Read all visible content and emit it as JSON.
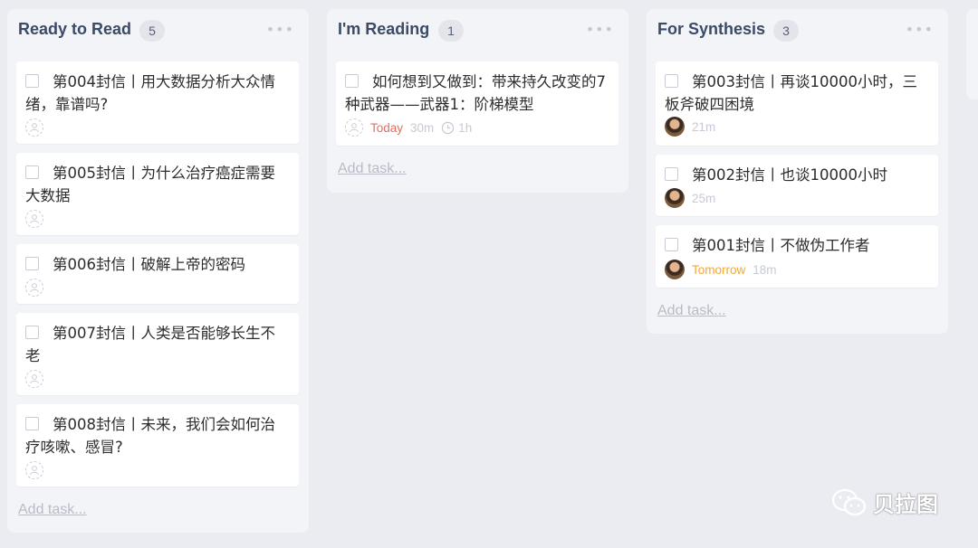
{
  "columns": [
    {
      "title": "Ready to Read",
      "count": "5",
      "menu": "•••",
      "cards": [
        {
          "title": "第004封信丨用大数据分析大众情绪，靠谱吗?"
        },
        {
          "title": "第005封信丨为什么治疗癌症需要大数据"
        },
        {
          "title": "第006封信丨破解上帝的密码"
        },
        {
          "title": "第007封信丨人类是否能够长生不老"
        },
        {
          "title": "第008封信丨未来，我们会如何治疗咳嗽、感冒?"
        }
      ],
      "add_task": "Add task..."
    },
    {
      "title": "I'm Reading",
      "count": "1",
      "menu": "•••",
      "cards": [
        {
          "title": "如何想到又做到：带来持久改变的7种武器——武器1：阶梯模型",
          "due": "Today",
          "estimate": "30m",
          "time_spent": "1h"
        }
      ],
      "add_task": "Add task..."
    },
    {
      "title": "For Synthesis",
      "count": "3",
      "menu": "•••",
      "cards": [
        {
          "title": "第003封信丨再谈10000小时，三板斧破四困境",
          "estimate": "21m"
        },
        {
          "title": "第002封信丨也谈10000小时",
          "estimate": "25m"
        },
        {
          "title": "第001封信丨不做伪工作者",
          "due": "Tomorrow",
          "estimate": "18m"
        }
      ],
      "add_task": "Add task..."
    }
  ],
  "watermark": {
    "text": "贝拉图",
    "icon": "wechat-icon"
  },
  "colors": {
    "background": "#ebecf1",
    "column": "#f3f4f7",
    "title": "#3b4a66",
    "due_today": "#e46e5c",
    "due_tomorrow": "#f1a83a",
    "muted": "#c5cad4"
  }
}
